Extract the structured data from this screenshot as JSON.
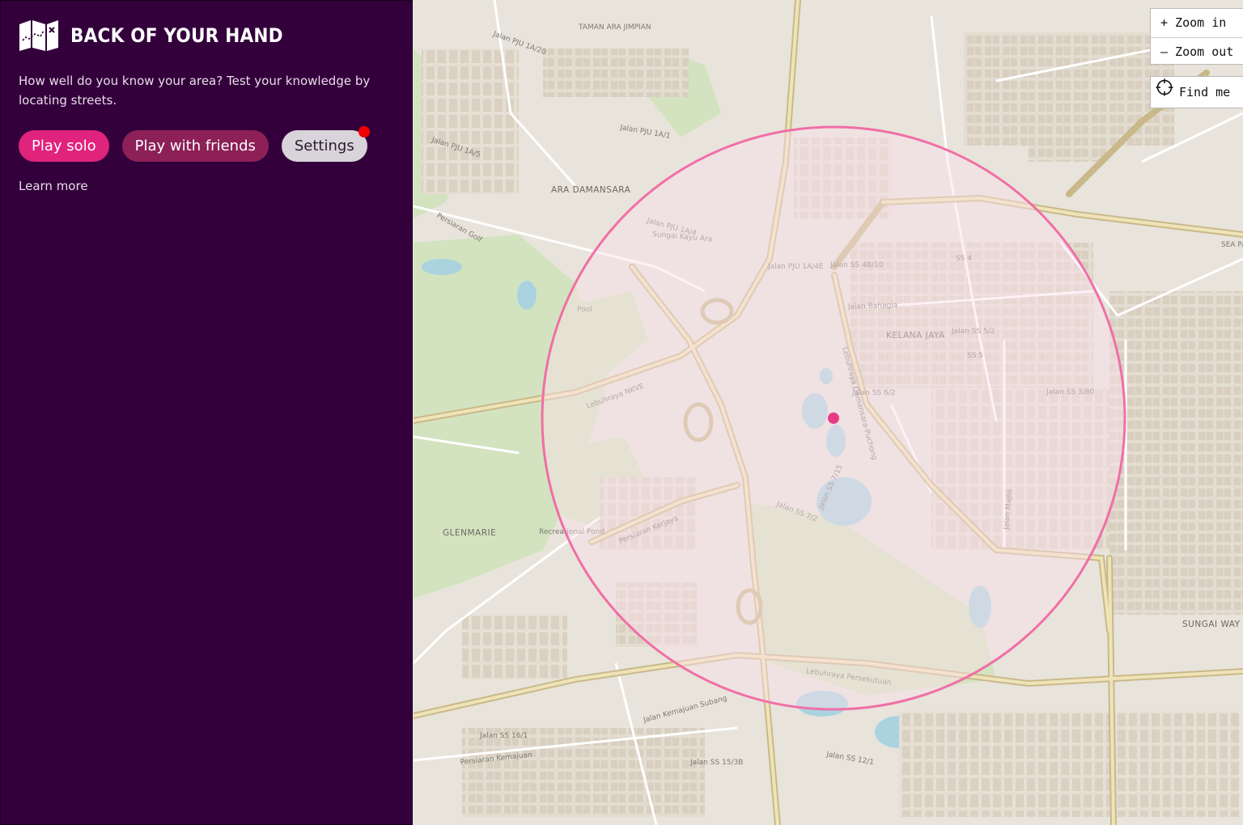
{
  "sidebar": {
    "title": "BACK OF YOUR HAND",
    "tagline": "How well do you know your area? Test your knowledge by locating streets.",
    "buttons": {
      "play_solo": "Play solo",
      "play_friends": "Play with friends",
      "settings": "Settings"
    },
    "learn_more": "Learn more",
    "logo_icon": "folded-map-icon"
  },
  "map_controls": {
    "zoom_in": "+ Zoom in",
    "zoom_out": "– Zoom out",
    "find_me": "Find me",
    "find_icon": "crosshair-icon"
  },
  "map": {
    "areas": [
      "ARA DAMANSARA",
      "KELANA JAYA",
      "GLENMARIE",
      "SUNGAI WAY",
      "SS 5",
      "SS 4",
      "TAMAN ARA JIMPIAN"
    ],
    "roads": [
      "Jalan PJU 1A/20",
      "Jalan PJU 1A/5",
      "Jalan PJU 1A/1",
      "Jalan PJU 1A/4",
      "Jalan PJU 1A/4E",
      "Persiaran Golf",
      "Lebuhraya NKVE",
      "Jalan Bahagia",
      "Jalan SS 4B/10",
      "Jalan SS 5/2",
      "Jalan SS 6/2",
      "Jalan SS 3/80",
      "Jalan SS 7/2",
      "Jalan SS 7/15",
      "Persiaran Kerjaya",
      "Lebuhraya Persekutuan",
      "Jalan Kemajuan Subang",
      "Persiaran Kemajuan",
      "Jalan SS 16/1",
      "Jalan SS 15/3B",
      "Jalan SS 12/1",
      "Jalan Majlis",
      "Sungai Kayu Ara",
      "Lebuhraya Damansara-Puchong",
      "Recreational Pond",
      "Pool",
      "SEA PARK"
    ],
    "colors": {
      "circle": "#f06fa6",
      "target_dot": "#e83a87",
      "sidebar_bg": "#33003b",
      "accent": "#e0237d"
    }
  }
}
